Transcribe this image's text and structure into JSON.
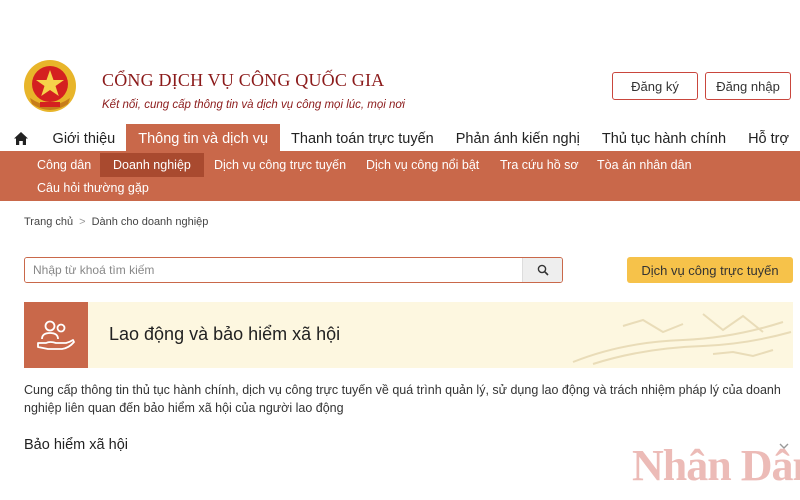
{
  "header": {
    "logo_title": "CỔNG DỊCH VỤ CÔNG QUỐC GIA",
    "logo_subtitle": "Kết nối, cung cấp thông tin và dịch vụ công mọi lúc, mọi nơi",
    "register_label": "Đăng ký",
    "login_label": "Đăng nhập"
  },
  "mainnav": {
    "items": [
      {
        "label": "Giới thiệu"
      },
      {
        "label": "Thông tin và dịch vụ"
      },
      {
        "label": "Thanh toán trực tuyến"
      },
      {
        "label": "Phản ánh kiến nghị"
      },
      {
        "label": "Thủ tục hành chính"
      },
      {
        "label": "Hỗ trợ"
      }
    ]
  },
  "subnav": {
    "items": [
      {
        "label": "Công dân"
      },
      {
        "label": "Doanh nghiệp"
      },
      {
        "label": "Dịch vụ công trực tuyến"
      },
      {
        "label": "Dịch vụ công nổi bật"
      },
      {
        "label": "Tra cứu hồ sơ"
      },
      {
        "label": "Tòa án nhân dân"
      },
      {
        "label": "Câu hỏi thường gặp"
      }
    ]
  },
  "breadcrumb": {
    "home": "Trang chủ",
    "separator": ">",
    "current": "Dành cho doanh nghiệp"
  },
  "search": {
    "placeholder": "Nhập từ khoá tìm kiếm",
    "service_button": "Dịch vụ công trực tuyến"
  },
  "banner": {
    "title": "Lao động và bảo hiểm xã hội"
  },
  "description": "Cung cấp thông tin thủ tục hành chính, dịch vụ công trực tuyến về quá trình quản lý, sử dụng lao động và trách nhiệm pháp lý của doanh nghiệp liên quan đến bảo hiểm xã hội của người lao động",
  "section": {
    "title": "Bảo hiểm xã hội"
  },
  "watermark": "Nhân Dân",
  "colors": {
    "accent": "#c9684a",
    "accent_dark": "#a94a2f",
    "brand_red": "#8b1a1a",
    "button_yellow": "#f6c24a",
    "banner_bg": "#fdf7e0"
  },
  "icons": [
    "national-emblem-icon",
    "home-icon",
    "search-icon",
    "hand-people-icon",
    "chevron-down-icon"
  ]
}
